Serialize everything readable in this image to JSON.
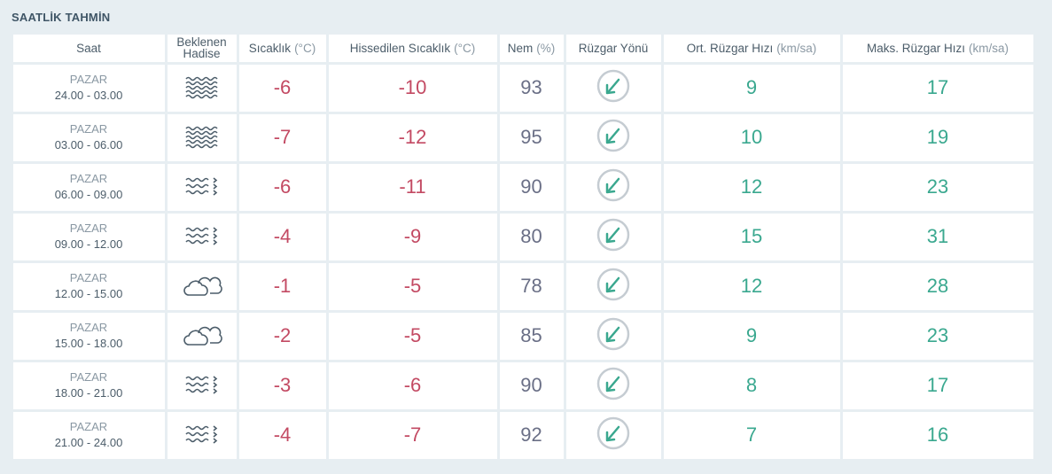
{
  "title": "SAATLİK TAHMİN",
  "headers": {
    "saat": "Saat",
    "hadise_line1": "Beklenen",
    "hadise_line2": "Hadise",
    "sicaklik": "Sıcaklık",
    "sicaklik_unit": "(°C)",
    "hissedilen": "Hissedilen Sıcaklık",
    "hissedilen_unit": "(°C)",
    "nem": "Nem",
    "nem_unit": "(%)",
    "yon": "Rüzgar Yönü",
    "ort": "Ort. Rüzgar Hızı",
    "ort_unit": "(km/sa)",
    "maks": "Maks. Rüzgar Hızı",
    "maks_unit": "(km/sa)"
  },
  "colors": {
    "temperature": "#c34a63",
    "humidity": "#6a6f86",
    "wind": "#3aa88f"
  },
  "rows": [
    {
      "day": "PAZAR",
      "time": "24.00 - 03.00",
      "icon": "fog-icon",
      "temp": "-6",
      "feels": "-10",
      "humidity": "93",
      "avg_wind": "9",
      "max_wind": "17"
    },
    {
      "day": "PAZAR",
      "time": "03.00 - 06.00",
      "icon": "fog-icon",
      "temp": "-7",
      "feels": "-12",
      "humidity": "95",
      "avg_wind": "10",
      "max_wind": "19"
    },
    {
      "day": "PAZAR",
      "time": "06.00 - 09.00",
      "icon": "fog-snow-icon",
      "temp": "-6",
      "feels": "-11",
      "humidity": "90",
      "avg_wind": "12",
      "max_wind": "23"
    },
    {
      "day": "PAZAR",
      "time": "09.00 - 12.00",
      "icon": "fog-snow-icon",
      "temp": "-4",
      "feels": "-9",
      "humidity": "80",
      "avg_wind": "15",
      "max_wind": "31"
    },
    {
      "day": "PAZAR",
      "time": "12.00 - 15.00",
      "icon": "cloudy-icon",
      "temp": "-1",
      "feels": "-5",
      "humidity": "78",
      "avg_wind": "12",
      "max_wind": "28"
    },
    {
      "day": "PAZAR",
      "time": "15.00 - 18.00",
      "icon": "cloudy-icon",
      "temp": "-2",
      "feels": "-5",
      "humidity": "85",
      "avg_wind": "9",
      "max_wind": "23"
    },
    {
      "day": "PAZAR",
      "time": "18.00 - 21.00",
      "icon": "fog-snow-icon",
      "temp": "-3",
      "feels": "-6",
      "humidity": "90",
      "avg_wind": "8",
      "max_wind": "17"
    },
    {
      "day": "PAZAR",
      "time": "21.00 - 24.00",
      "icon": "fog-snow-icon",
      "temp": "-4",
      "feels": "-7",
      "humidity": "92",
      "avg_wind": "7",
      "max_wind": "16"
    }
  ]
}
